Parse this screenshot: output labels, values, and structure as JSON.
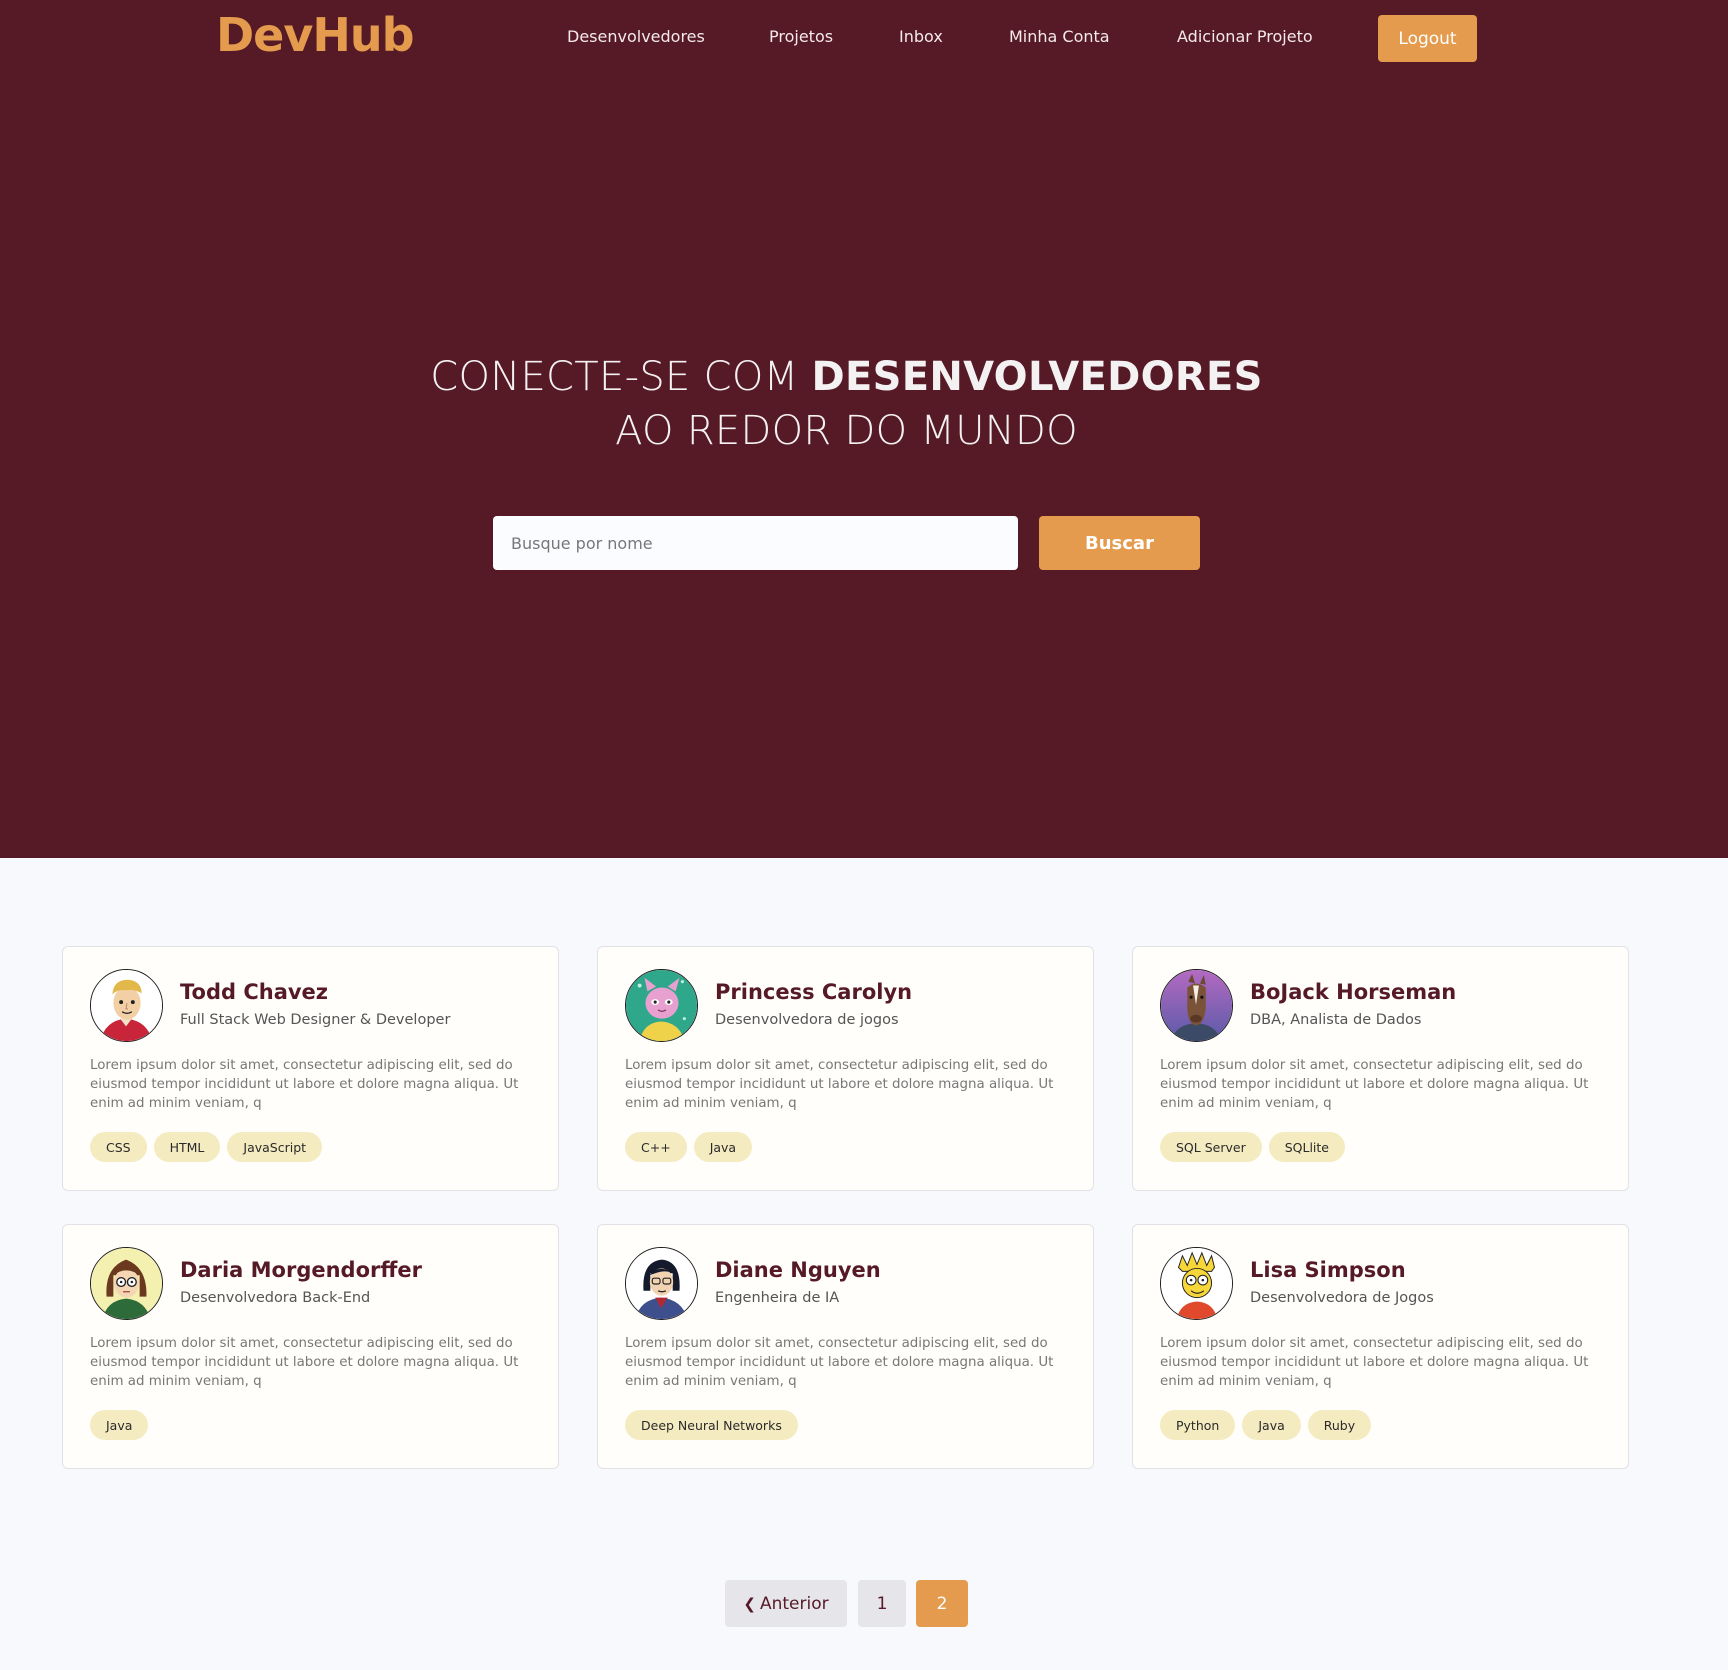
{
  "brand": {
    "logo_text": "DevHub",
    "accent_color": "#e49b4d",
    "primary_color": "#561a26"
  },
  "nav": {
    "links": [
      {
        "label": "Desenvolvedores"
      },
      {
        "label": "Projetos"
      },
      {
        "label": "Inbox"
      },
      {
        "label": "Minha Conta"
      },
      {
        "label": "Adicionar Projeto"
      }
    ],
    "logout_label": "Logout"
  },
  "hero": {
    "title_part1": "CONECTE-SE COM ",
    "title_strong": "DESENVOLVEDORES",
    "title_line2": "AO REDOR DO MUNDO"
  },
  "search": {
    "placeholder": "Busque por nome",
    "value": "",
    "button_label": "Buscar"
  },
  "developers": [
    {
      "name": "Todd Chavez",
      "role": "Full Stack Web Designer & Developer",
      "bio": "Lorem ipsum dolor sit amet, consectetur adipiscing elit, sed do eiusmod tempor incididunt ut labore et dolore magna aliqua. Ut enim ad minim veniam, q",
      "tags": [
        "CSS",
        "HTML",
        "JavaScript"
      ],
      "avatar_icon": "todd-avatar"
    },
    {
      "name": "Princess Carolyn",
      "role": "Desenvolvedora de jogos",
      "bio": "Lorem ipsum dolor sit amet, consectetur adipiscing elit, sed do eiusmod tempor incididunt ut labore et dolore magna aliqua. Ut enim ad minim veniam, q",
      "tags": [
        "C++",
        "Java"
      ],
      "avatar_icon": "princess-carolyn-avatar"
    },
    {
      "name": "BoJack Horseman",
      "role": "DBA, Analista de Dados",
      "bio": "Lorem ipsum dolor sit amet, consectetur adipiscing elit, sed do eiusmod tempor incididunt ut labore et dolore magna aliqua. Ut enim ad minim veniam, q",
      "tags": [
        "SQL Server",
        "SQLlite"
      ],
      "avatar_icon": "bojack-avatar"
    },
    {
      "name": "Daria Morgendorffer",
      "role": "Desenvolvedora Back-End",
      "bio": "Lorem ipsum dolor sit amet, consectetur adipiscing elit, sed do eiusmod tempor incididunt ut labore et dolore magna aliqua. Ut enim ad minim veniam, q",
      "tags": [
        "Java"
      ],
      "avatar_icon": "daria-avatar"
    },
    {
      "name": "Diane Nguyen",
      "role": "Engenheira de IA",
      "bio": "Lorem ipsum dolor sit amet, consectetur adipiscing elit, sed do eiusmod tempor incididunt ut labore et dolore magna aliqua. Ut enim ad minim veniam, q",
      "tags": [
        "Deep Neural Networks"
      ],
      "avatar_icon": "diane-avatar"
    },
    {
      "name": "Lisa Simpson",
      "role": "Desenvolvedora de Jogos",
      "bio": "Lorem ipsum dolor sit amet, consectetur adipiscing elit, sed do eiusmod tempor incididunt ut labore et dolore magna aliqua. Ut enim ad minim veniam, q",
      "tags": [
        "Python",
        "Java",
        "Ruby"
      ],
      "avatar_icon": "lisa-avatar"
    }
  ],
  "pagination": {
    "prev_label": "Anterior",
    "prev_icon": "chevron-left-icon",
    "pages": [
      "1",
      "2"
    ],
    "current_page": "2"
  }
}
